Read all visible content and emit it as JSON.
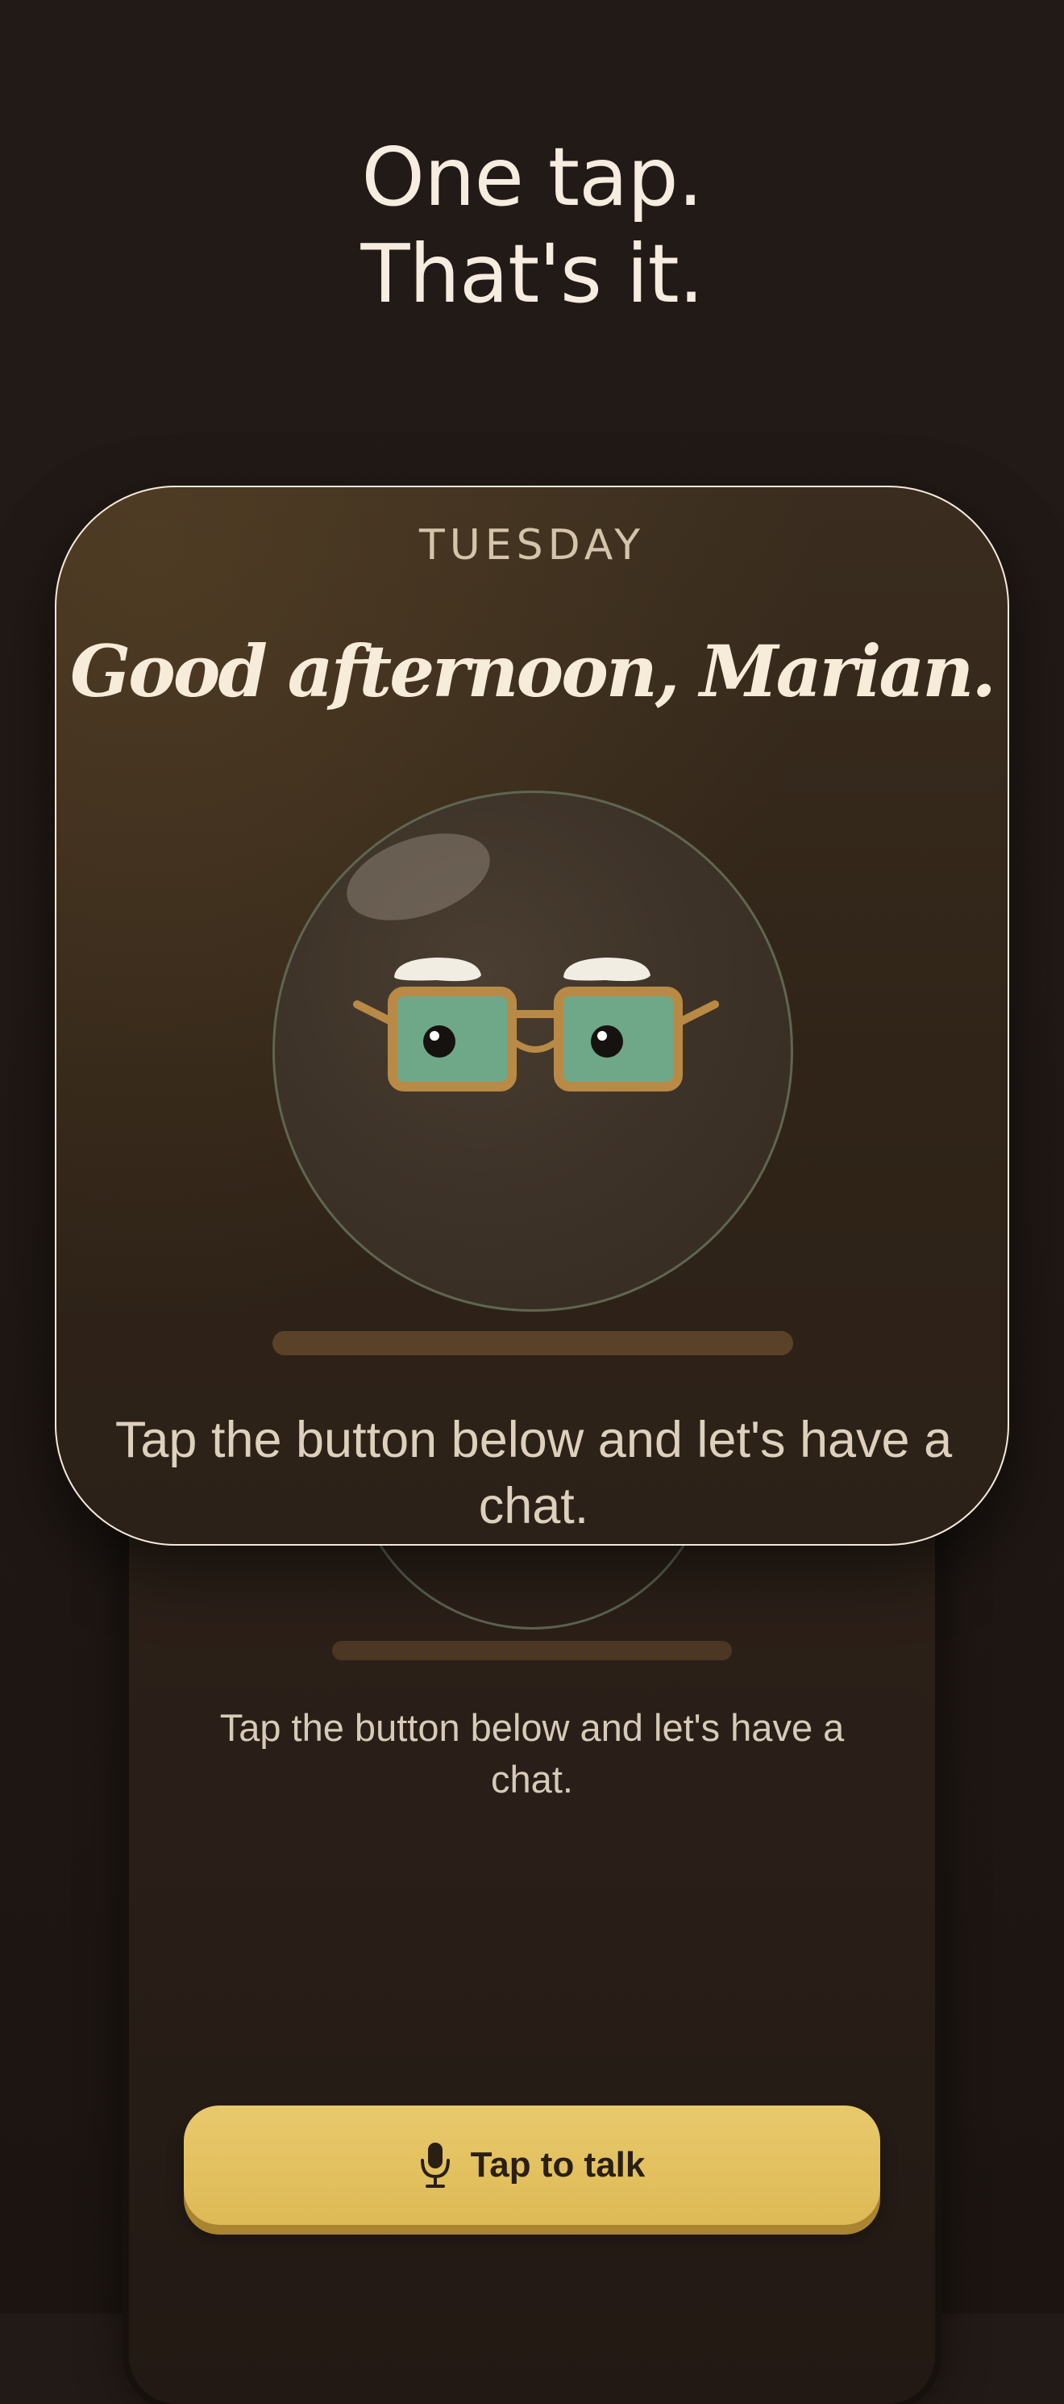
{
  "headline": {
    "line1": "One tap.",
    "line2": "That's it."
  },
  "card": {
    "day": "TUESDAY",
    "greeting": "Good afternoon, Marian.",
    "subtitle": "Tap the button below and let's have a chat."
  },
  "phone": {
    "subtitle": "Tap the button below and let's have a chat."
  },
  "talk_button": {
    "label": "Tap to talk",
    "icon": "microphone-icon"
  },
  "colors": {
    "background": "#221a17",
    "accent_gold": "#e2c061",
    "card_border": "#f4eadb",
    "lens_green": "#6fa889",
    "frame_gold": "#b98a45"
  }
}
